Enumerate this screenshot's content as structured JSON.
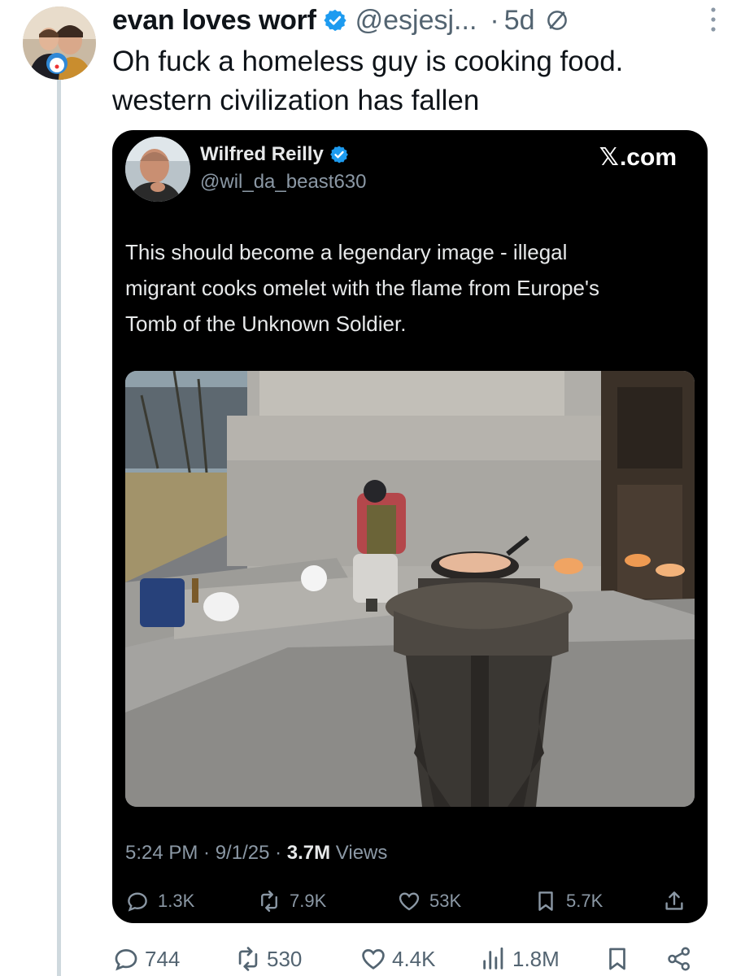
{
  "tweet": {
    "display_name": "evan loves worf",
    "handle": "@esjesj...",
    "separator": "·",
    "age": "5d",
    "text_line1": "Oh fuck a homeless guy is cooking food.",
    "text_line2": "western civilization has fallen"
  },
  "quote": {
    "display_name": "Wilfred Reilly",
    "handle": "@wil_da_beast630",
    "source": ".com",
    "source_logo": "𝕏",
    "text_line1": "This should become a legendary image - illegal",
    "text_line2": "migrant cooks omelet with the flame from Europe's",
    "text_line3": "Tomb of the Unknown Soldier.",
    "timestamp": "5:24 PM · 9/1/25 · ",
    "views_count": "3.7M",
    "views_label": " Views",
    "replies": "1.3K",
    "reposts": "7.9K",
    "likes": "53K",
    "bookmarks": "5.7K"
  },
  "actions": {
    "replies": "744",
    "reposts": "530",
    "likes": "4.4K",
    "views": "1.8M"
  },
  "colors": {
    "verified_blue": "#1d9bf0",
    "muted_text": "#536471",
    "card_bg": "#000000"
  },
  "icons": {
    "reply": "reply-icon",
    "repost": "repost-icon",
    "like": "heart-icon",
    "views": "views-icon",
    "bookmark": "bookmark-icon",
    "share": "share-icon",
    "upload": "upload-icon",
    "blocked": "blocked-icon",
    "more": "more-icon",
    "verified": "verified-badge-icon"
  }
}
